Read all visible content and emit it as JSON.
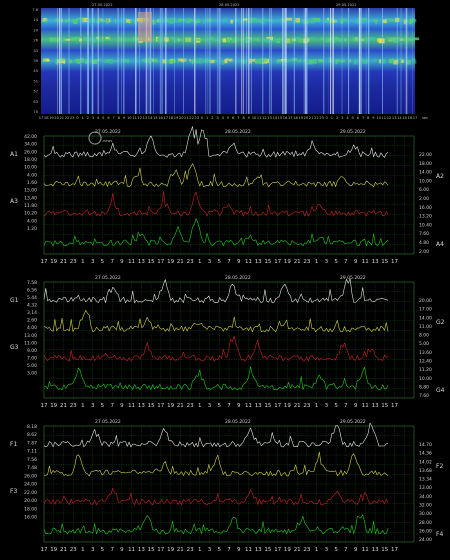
{
  "dates": [
    "27.05.2022",
    "28.05.2022",
    "29.05.2022"
  ],
  "spectrogram": {
    "y_labels": [
      "7.8",
      "14",
      "20",
      "26",
      "33",
      "39",
      "45",
      "51",
      "57",
      "63",
      "70"
    ],
    "hour_labels_top": [
      "17",
      "18",
      "19",
      "20",
      "21",
      "22",
      "23",
      "0",
      "1",
      "2",
      "3",
      "4",
      "5",
      "6",
      "7",
      "8",
      "9",
      "10",
      "11",
      "12",
      "13",
      "14",
      "15",
      "16",
      "17",
      "18",
      "19",
      "20",
      "21",
      "22",
      "23",
      "0",
      "1",
      "2",
      "3",
      "4",
      "5",
      "6",
      "7",
      "8",
      "9",
      "10",
      "11",
      "12",
      "13",
      "14",
      "15",
      "16",
      "17",
      "18",
      "19",
      "20",
      "21",
      "22",
      "23",
      "0",
      "1",
      "2",
      "3",
      "4",
      "5",
      "6",
      "7",
      "8",
      "9",
      "10",
      "11",
      "12",
      "13",
      "14",
      "15",
      "16",
      "17"
    ],
    "unit": "sec"
  },
  "chart_data": [
    {
      "type": "line",
      "title": "",
      "left_axis": {
        "label_top": "A1",
        "label_bottom": "A3",
        "ticks": [
          "42.00",
          "34.00",
          "26.00",
          "18.00",
          "10.00",
          "4.00",
          "1.60",
          "15.00",
          "13.40",
          "11.80",
          "10.20",
          "4.00",
          "1.20"
        ]
      },
      "right_axis": {
        "label_top": "A2",
        "label_bottom": "A4",
        "ticks": [
          "22.00",
          "18.00",
          "14.00",
          "10.00",
          "6.00",
          "2.00",
          "16.00",
          "13.20",
          "10.40",
          "7.60",
          "4.80",
          "2.00"
        ]
      },
      "x_ticks": [
        "17",
        "19",
        "21",
        "23",
        "1",
        "3",
        "5",
        "7",
        "9",
        "11",
        "13",
        "15",
        "17",
        "19",
        "21",
        "23",
        "1",
        "3",
        "5",
        "7",
        "9",
        "11",
        "13",
        "15",
        "17",
        "19",
        "21",
        "23",
        "1",
        "3",
        "5",
        "7",
        "9",
        "11",
        "13",
        "15",
        "17"
      ],
      "series": [
        {
          "color": "#e8e8e8",
          "band": 0,
          "peaks": [
            [
              0.43,
              0.95
            ],
            [
              0.46,
              0.85
            ],
            [
              0.31,
              0.55
            ],
            [
              0.2,
              0.3
            ],
            [
              0.78,
              0.4
            ],
            [
              0.9,
              0.3
            ],
            [
              0.55,
              0.35
            ]
          ]
        },
        {
          "color": "#d6d64a",
          "band": 1,
          "peaks": [
            [
              0.43,
              0.8
            ],
            [
              0.38,
              0.5
            ],
            [
              0.27,
              0.35
            ],
            [
              0.62,
              0.25
            ],
            [
              0.87,
              0.3
            ]
          ]
        },
        {
          "color": "#cc2222",
          "band": 2,
          "peaks": [
            [
              0.44,
              0.8
            ],
            [
              0.35,
              0.45
            ],
            [
              0.2,
              0.35
            ],
            [
              0.53,
              0.3
            ],
            [
              0.8,
              0.25
            ]
          ]
        },
        {
          "color": "#22cc22",
          "band": 3,
          "peaks": [
            [
              0.44,
              0.95
            ],
            [
              0.39,
              0.55
            ],
            [
              0.28,
              0.35
            ],
            [
              0.8,
              0.25
            ],
            [
              0.6,
              0.2
            ]
          ]
        }
      ]
    },
    {
      "type": "line",
      "title": "",
      "left_axis": {
        "label_top": "G1",
        "label_bottom": "G3",
        "ticks": [
          "7.58",
          "6.56",
          "5.44",
          "4.32",
          "3.14",
          "2.60",
          "4.00",
          "13.00",
          "11.00",
          "9.00",
          "7.00",
          "5.00",
          "3.00"
        ]
      },
      "right_axis": {
        "label_top": "G2",
        "label_bottom": "G4",
        "ticks": [
          "20.00",
          "17.00",
          "14.00",
          "11.00",
          "8.00",
          "5.00",
          "13.60",
          "12.40",
          "11.20",
          "10.00",
          "8.80",
          "7.60"
        ]
      },
      "x_ticks": [
        "17",
        "19",
        "21",
        "23",
        "1",
        "3",
        "5",
        "7",
        "9",
        "11",
        "13",
        "15",
        "17",
        "19",
        "21",
        "23",
        "1",
        "3",
        "5",
        "7",
        "9",
        "11",
        "13",
        "15",
        "17",
        "19",
        "21",
        "23",
        "1",
        "3",
        "5",
        "7",
        "9",
        "11",
        "13",
        "15",
        "17"
      ],
      "series": [
        {
          "color": "#e8e8e8",
          "band": 0,
          "peaks": [
            [
              0.35,
              0.7
            ],
            [
              0.55,
              0.6
            ],
            [
              0.7,
              0.55
            ],
            [
              0.88,
              0.75
            ],
            [
              0.2,
              0.5
            ]
          ]
        },
        {
          "color": "#d6d64a",
          "band": 1,
          "peaks": [
            [
              0.12,
              0.8
            ],
            [
              0.3,
              0.45
            ],
            [
              0.45,
              0.3
            ],
            [
              0.7,
              0.25
            ]
          ]
        },
        {
          "color": "#cc2222",
          "band": 2,
          "peaks": [
            [
              0.55,
              0.75
            ],
            [
              0.62,
              0.6
            ],
            [
              0.3,
              0.45
            ],
            [
              0.87,
              0.5
            ],
            [
              0.95,
              0.4
            ]
          ]
        },
        {
          "color": "#22cc22",
          "band": 3,
          "peaks": [
            [
              0.1,
              0.6
            ],
            [
              0.45,
              0.55
            ],
            [
              0.6,
              0.6
            ],
            [
              0.8,
              0.45
            ],
            [
              0.93,
              0.6
            ]
          ]
        }
      ]
    },
    {
      "type": "line",
      "title": "",
      "left_axis": {
        "label_top": "F1",
        "label_bottom": "F3",
        "ticks": [
          "8.18",
          "8.62",
          "7.87",
          "7.11",
          "7.56",
          "7.48",
          "26.00",
          "24.00",
          "22.00",
          "20.00",
          "18.00",
          "16.00"
        ]
      },
      "right_axis": {
        "label_top": "F2",
        "label_bottom": "F4",
        "ticks": [
          "14.70",
          "14.36",
          "14.02",
          "13.68",
          "13.34",
          "13.00",
          "34.00",
          "32.00",
          "30.00",
          "28.00",
          "26.00",
          "24.00"
        ]
      },
      "x_ticks": [
        "17",
        "19",
        "21",
        "23",
        "1",
        "3",
        "5",
        "7",
        "9",
        "11",
        "13",
        "15",
        "17",
        "19",
        "21",
        "23",
        "1",
        "3",
        "5",
        "7",
        "9",
        "11",
        "13",
        "15",
        "17",
        "19",
        "21",
        "23",
        "1",
        "3",
        "5",
        "7",
        "9",
        "11",
        "13",
        "15",
        "17"
      ],
      "series": [
        {
          "color": "#e8e8e8",
          "band": 0,
          "peaks": [
            [
              0.35,
              0.6
            ],
            [
              0.6,
              0.5
            ],
            [
              0.85,
              0.75
            ],
            [
              0.95,
              0.85
            ],
            [
              0.15,
              0.45
            ]
          ]
        },
        {
          "color": "#d6d64a",
          "band": 1,
          "peaks": [
            [
              0.1,
              0.6
            ],
            [
              0.35,
              0.4
            ],
            [
              0.5,
              0.45
            ],
            [
              0.8,
              0.55
            ],
            [
              0.9,
              0.6
            ]
          ]
        },
        {
          "color": "#cc2222",
          "band": 2,
          "peaks": [
            [
              0.2,
              0.4
            ],
            [
              0.6,
              0.35
            ],
            [
              0.85,
              0.4
            ]
          ]
        },
        {
          "color": "#22cc22",
          "band": 3,
          "peaks": [
            [
              0.3,
              0.6
            ],
            [
              0.55,
              0.5
            ],
            [
              0.75,
              0.55
            ],
            [
              0.92,
              0.6
            ]
          ]
        }
      ]
    }
  ]
}
